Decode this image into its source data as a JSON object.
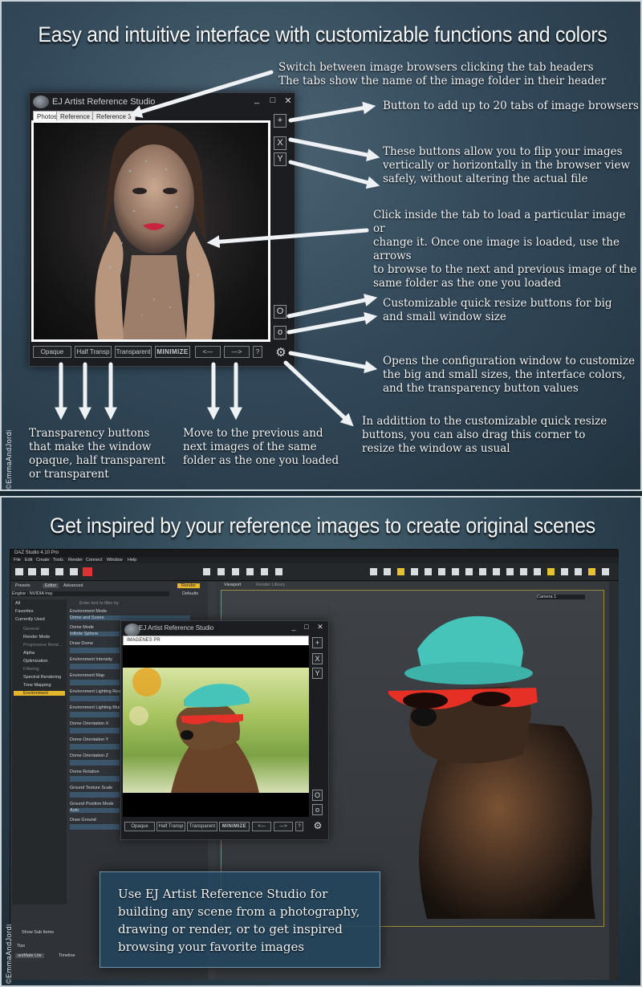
{
  "top": {
    "headline": "Easy and intuitive interface with customizable functions and colors",
    "window": {
      "title": "EJ Artist Reference Studio",
      "controls": [
        "_",
        "□",
        "✕"
      ],
      "tabs": [
        "Photos",
        "Reference 2",
        "Reference 3"
      ],
      "side_buttons": [
        "+",
        "X",
        "Y"
      ],
      "resize_buttons": [
        "O",
        "o"
      ],
      "bottom_buttons": [
        "Opaque",
        "Half Transp",
        "Transparent",
        "MINIMIZE",
        "<—",
        "—>",
        "?"
      ],
      "gear": "⚙"
    },
    "notes": {
      "tabs": "Switch between image browsers clicking the tab headers\nThe tabs show the name of the image folder in their header",
      "add": "Button to add up to 20 tabs of image browsers",
      "flip": "These buttons allow you to flip your images\nvertically or horizontally in the browser view\nsafely, without altering the actual file",
      "click": "Click inside the tab to load a particular image or\nchange it. Once one image is loaded, use the arrows\nto browse to the next and previous image of the\nsame folder as the one you loaded",
      "resize": "Customizable quick resize buttons for big\nand small window size",
      "config": "Opens the configuration window to customize\nthe big and small sizes, the interface colors,\nand the transparency button values",
      "corner": "In addittion to the customizable quick resize\nbuttons, you can also drag this corner to\nresize the window as usual",
      "transparency": "Transparency buttons\nthat make the window\nopaque, half transparent\nor transparent",
      "move": "Move to the previous and\nnext images of the same\nfolder as the one you loaded"
    },
    "credit": "©EmmaAndJordi"
  },
  "bottom": {
    "headline": "Get inspired by your reference images to create original scenes",
    "daz": {
      "title": "DAZ Studio 4.10 Pro",
      "menu": [
        "File",
        "Edit",
        "Create",
        "Tools",
        "Render",
        "Connect",
        "Window",
        "Help"
      ],
      "left_tabs": [
        "Presets",
        "Editor",
        "Advanced",
        "Render"
      ],
      "engine_label": "Engine : NVIDIA Iray",
      "defaults": "Defaults",
      "categories": [
        "All",
        "Favorites",
        "Currently Used",
        "General",
        "Render Mode",
        "Progressive Rend...",
        "Alpha",
        "Optimization",
        "Filtering",
        "Spectral Rendering",
        "Tone Mapping",
        "Environment"
      ],
      "filter_placeholder": "Enter text to filter by",
      "env_mode_label": "Environment Mode",
      "env_mode_value": "Dome and Scene",
      "params": [
        "Dome Mode",
        "Draw Dome",
        "Environment Intensity",
        "Environment Map",
        "Environment Lighting Resol...",
        "Environment Lighting Blur",
        "Dome Orientation X",
        "Dome Orientation Y",
        "Dome Orientation Z",
        "Dome Rotation",
        "Ground Texture Scale",
        "Ground Position Mode",
        "Draw Ground"
      ],
      "dome_mode_value": "Infinite Sphere",
      "ground_mode_value": "Auto",
      "viewport_tabs": [
        "Viewport",
        "Render Library"
      ],
      "camera": "Camera 1",
      "show_sub": "Show Sub Items",
      "tips": "Tips",
      "bottom_tabs": [
        "aniMate Lite",
        "Timeline"
      ],
      "side_label": "Render Settings"
    },
    "window": {
      "title": "EJ Artist Reference Studio",
      "controls": [
        "_",
        "□",
        "✕"
      ],
      "tab": "IMAGENES PR",
      "side_buttons": [
        "+",
        "X",
        "Y"
      ],
      "resize_buttons": [
        "O",
        "o"
      ],
      "bottom_buttons": [
        "Opaque",
        "Half Transp",
        "Transparent",
        "MINIMIZE",
        "<—",
        "—>",
        "?"
      ],
      "gear": "⚙"
    },
    "info": "Use EJ Artist Reference Studio for\nbuilding any scene from a photography,\ndrawing or render, or to get inspired\nbrowsing your favorite images",
    "credit": "©EmmaAndJordi"
  }
}
